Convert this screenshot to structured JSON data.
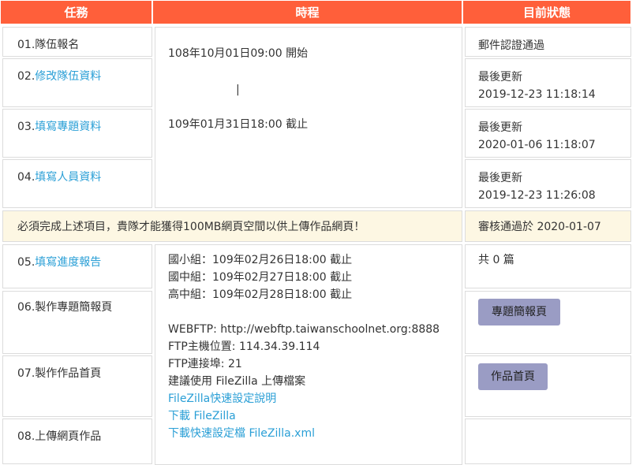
{
  "header": {
    "task": "任務",
    "schedule": "時程",
    "status": "目前狀態"
  },
  "tasks": [
    {
      "num": "01.",
      "label": "隊伍報名",
      "link": false
    },
    {
      "num": "02.",
      "label": "修改隊伍資料",
      "link": true
    },
    {
      "num": "03.",
      "label": "填寫專題資料",
      "link": true
    },
    {
      "num": "04.",
      "label": "填寫人員資料",
      "link": true
    },
    {
      "num": "05.",
      "label": "填寫進度報告",
      "link": true
    },
    {
      "num": "06.",
      "label": "製作專題簡報頁",
      "link": false
    },
    {
      "num": "07.",
      "label": "製作作品首頁",
      "link": false
    },
    {
      "num": "08.",
      "label": "上傳網頁作品",
      "link": false
    }
  ],
  "schedule1": {
    "start": "108年10月01日09:00 開始",
    "separator": "|",
    "end": "109年01月31日18:00 截止"
  },
  "status1": {
    "s1": "郵件認證通過",
    "s2_label": "最後更新",
    "s2_time": "2019-12-23 11:18:14",
    "s3_label": "最後更新",
    "s3_time": "2020-01-06 11:18:07",
    "s4_label": "最後更新",
    "s4_time": "2019-12-23 11:26:08"
  },
  "notice": {
    "text": "必須完成上述項目，貴隊才能獲得100MB網頁空間以供上傳作品網頁！",
    "status": "審核通過於 2020-01-07"
  },
  "schedule2": {
    "elementary": "國小組：109年02月26日18:00 截止",
    "junior": "國中組：109年02月27日18:00 截止",
    "senior": "高中組：109年02月28日18:00 截止",
    "webftp": "WEBFTP: http://webftp.taiwanschoolnet.org:8888",
    "ftp_host": "FTP主機位置: 114.34.39.114",
    "ftp_port": "FTP連接埠: 21",
    "suggest": "建議使用 FileZilla 上傳檔案",
    "link_guide": "FileZilla快速設定說明",
    "link_download": "下載 FileZilla",
    "link_config": "下載快速設定檔 FileZilla.xml"
  },
  "status2": {
    "count": "共 0 篇",
    "btn_slides": "專題簡報頁",
    "btn_home": "作品首頁"
  }
}
